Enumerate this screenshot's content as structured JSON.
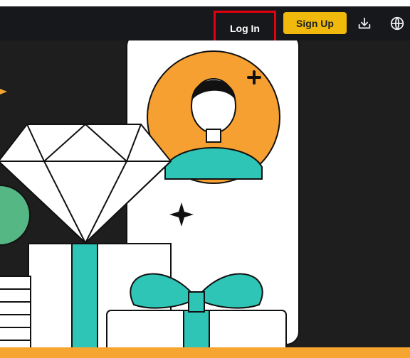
{
  "header": {
    "login_label": "Log In",
    "signup_label": "Sign Up",
    "download_icon": "download-icon",
    "language_icon": "globe-icon"
  },
  "colors": {
    "header_bg": "#16181b",
    "hero_bg": "#1e1e1e",
    "accent_yellow": "#f0b90b",
    "highlight_red": "#e3000f",
    "illustration_orange": "#f6a530",
    "illustration_teal": "#2ec4b6"
  }
}
